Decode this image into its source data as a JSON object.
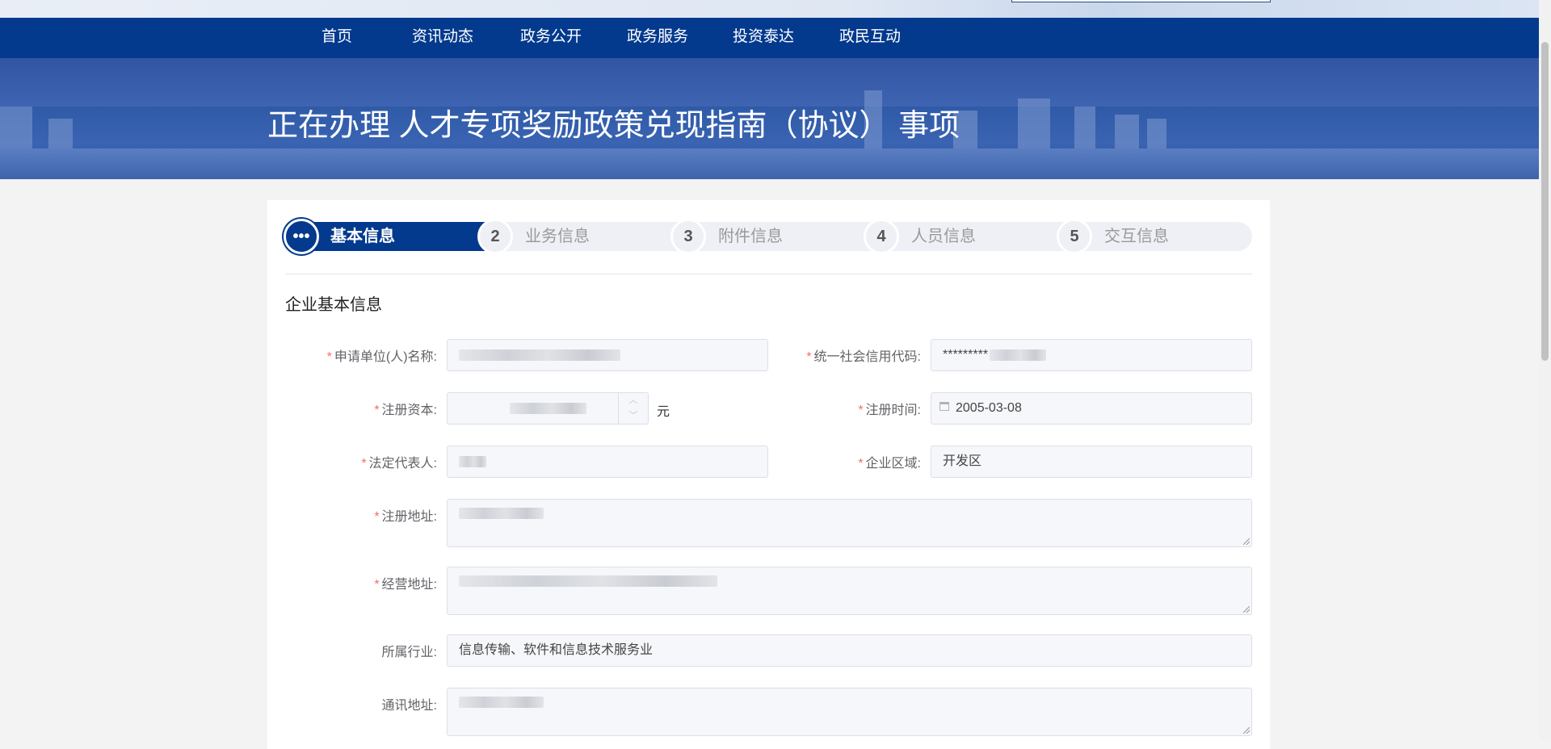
{
  "nav": {
    "items": [
      "首页",
      "资讯动态",
      "政务公开",
      "政务服务",
      "投资泰达",
      "政民互动"
    ]
  },
  "banner": {
    "title": "正在办理 人才专项奖励政策兑现指南（协议） 事项"
  },
  "steps": [
    {
      "icon": "•••",
      "label": "基本信息",
      "active": true
    },
    {
      "icon": "2",
      "label": "业务信息",
      "active": false
    },
    {
      "icon": "3",
      "label": "附件信息",
      "active": false
    },
    {
      "icon": "4",
      "label": "人员信息",
      "active": false
    },
    {
      "icon": "5",
      "label": "交互信息",
      "active": false
    }
  ],
  "section": {
    "title": "企业基本信息"
  },
  "form": {
    "required_mark": "*",
    "applicant_name": {
      "label": "申请单位(人)名称:",
      "value": ""
    },
    "credit_code": {
      "label": "统一社会信用代码:",
      "value": "*********"
    },
    "registered_capital": {
      "label": "注册资本:",
      "value": "",
      "unit": "元"
    },
    "register_date": {
      "label": "注册时间:",
      "value": "2005-03-08"
    },
    "legal_rep": {
      "label": "法定代表人:",
      "value": ""
    },
    "region": {
      "label": "企业区域:",
      "value": "开发区"
    },
    "reg_address": {
      "label": "注册地址:",
      "value": ""
    },
    "biz_address": {
      "label": "经营地址:",
      "value": ""
    },
    "industry": {
      "label": "所属行业:",
      "value": "信息传输、软件和信息技术服务业"
    },
    "mail_address": {
      "label": "通讯地址:",
      "value": ""
    }
  },
  "colors": {
    "nav_bg": "#033a8e",
    "required": "#f56c6c",
    "input_bg": "#f5f7fa"
  }
}
